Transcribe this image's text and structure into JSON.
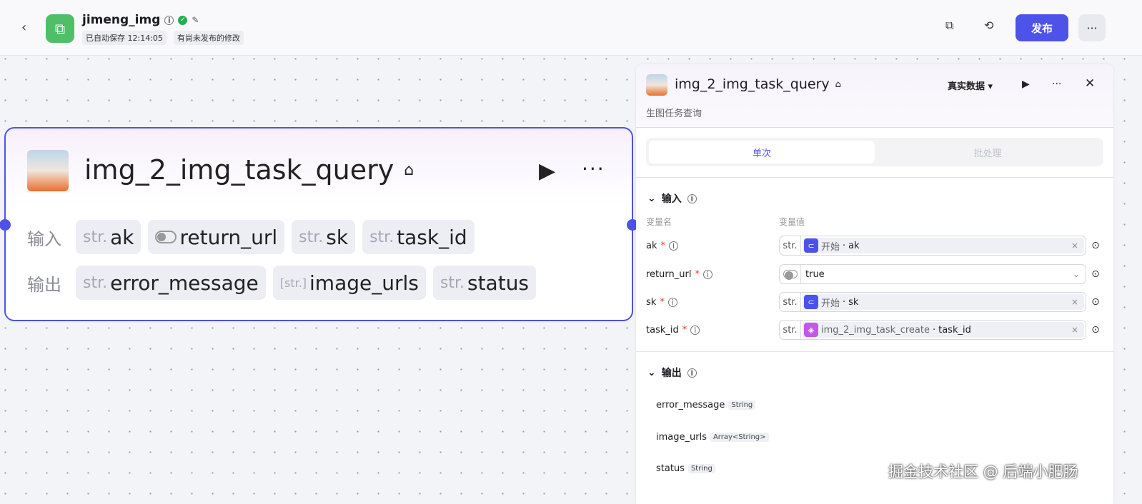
{
  "header": {
    "title": "jimeng_img",
    "autosave": "已自动保存 12:14:05",
    "unpublished": "有尚未发布的修改",
    "publish": "发布",
    "more": "···"
  },
  "node": {
    "title": "img_2_img_task_query",
    "input_label": "输入",
    "output_label": "输出",
    "inputs": [
      {
        "type": "str.",
        "name": "ak"
      },
      {
        "type": "bool",
        "name": "return_url"
      },
      {
        "type": "str.",
        "name": "sk"
      },
      {
        "type": "str.",
        "name": "task_id"
      }
    ],
    "outputs": [
      {
        "type": "str.",
        "name": "error_message"
      },
      {
        "type": "[str.]",
        "name": "image_urls"
      },
      {
        "type": "str.",
        "name": "status"
      }
    ]
  },
  "panel": {
    "title": "img_2_img_task_query",
    "subtitle": "生图任务查询",
    "data_mode": "真实数据 ▾",
    "tabs": [
      "单次",
      "批处理"
    ],
    "input_section": "输入",
    "col_name": "变量名",
    "col_value": "变量值",
    "inputs": [
      {
        "name": "ak",
        "type": "str.",
        "source": "开始",
        "field": "ak"
      },
      {
        "name": "return_url",
        "value": "true"
      },
      {
        "name": "sk",
        "type": "str.",
        "source": "开始",
        "field": "sk"
      },
      {
        "name": "task_id",
        "type": "str.",
        "source": "img_2_img_task_create",
        "field": "task_id"
      }
    ],
    "output_section": "输出",
    "outputs": [
      {
        "name": "error_message",
        "type": "String"
      },
      {
        "name": "image_urls",
        "type": "Array<String>"
      },
      {
        "name": "status",
        "type": "String"
      }
    ]
  },
  "watermark": "掘金技术社区 @ 后端小肥肠",
  "colors": {
    "accent": "#4d53e8",
    "success": "#23b04b",
    "logo": "#4fbf67"
  }
}
